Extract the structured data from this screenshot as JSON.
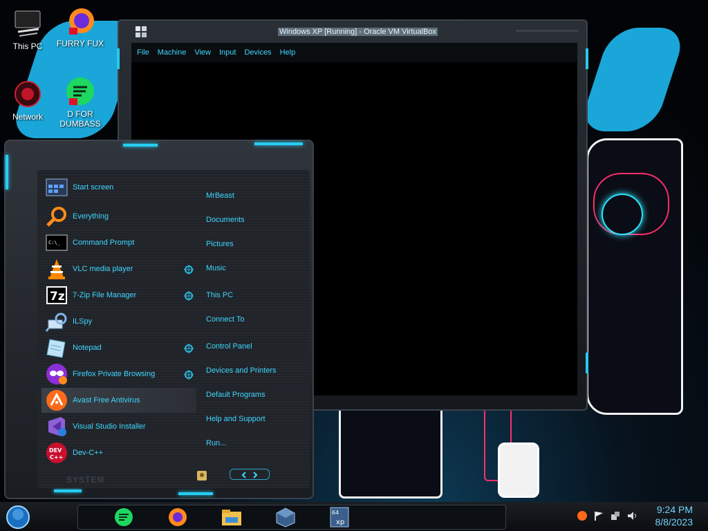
{
  "desktop": {
    "icons": [
      {
        "label": "This PC"
      },
      {
        "label": "FURRY FUX"
      },
      {
        "label": "Network"
      },
      {
        "label": "D FOR DUMBASS"
      }
    ]
  },
  "vm_window": {
    "title": "Windows XP [Running] - Oracle VM VirtualBox",
    "menu": [
      "File",
      "Machine",
      "View",
      "Input",
      "Devices",
      "Help"
    ]
  },
  "start_menu": {
    "programs": [
      {
        "label": "Start screen",
        "icon": "start-screen-icon"
      },
      {
        "label": "Everything",
        "icon": "magnifier-icon"
      },
      {
        "label": "Command Prompt",
        "icon": "terminal-icon"
      },
      {
        "label": "VLC media player",
        "icon": "vlc-cone-icon"
      },
      {
        "label": "7-Zip File Manager",
        "icon": "7zip-icon"
      },
      {
        "label": "ILSpy",
        "icon": "ilspy-icon"
      },
      {
        "label": "Notepad",
        "icon": "notepad-icon"
      },
      {
        "label": "Firefox Private Browsing",
        "icon": "firefox-private-icon"
      },
      {
        "label": "Avast Free Antivirus",
        "icon": "avast-icon"
      },
      {
        "label": "Visual Studio Installer",
        "icon": "visual-studio-icon"
      },
      {
        "label": "Dev-C++",
        "icon": "devcpp-icon"
      }
    ],
    "places": [
      "MrBeast",
      "Documents",
      "Pictures",
      "Music",
      "This PC",
      "Connect To",
      "Control Panel",
      "Devices and Printers",
      "Default Programs",
      "Help and Support",
      "Run..."
    ],
    "system_label": "SYSTEM"
  },
  "taskbar": {
    "time": "9:24 PM",
    "date": "8/8/2023"
  },
  "colors": {
    "accent": "#3fd7ff",
    "frame": "#2a2f36"
  }
}
